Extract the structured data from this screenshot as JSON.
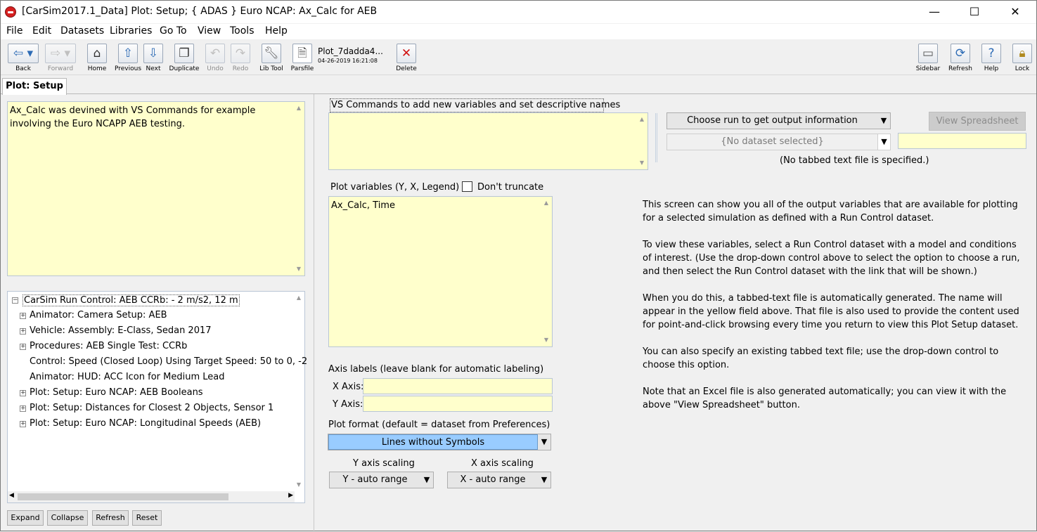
{
  "window": {
    "title": "[CarSim2017.1_Data] Plot: Setup; { ADAS } Euro NCAP: Ax_Calc for AEB",
    "minimize": "—",
    "maximize": "☐",
    "close": "✕"
  },
  "menu": [
    "File",
    "Edit",
    "Datasets",
    "Libraries",
    "Go To",
    "View",
    "Tools",
    "Help"
  ],
  "toolbar": {
    "back": "Back",
    "forward": "Forward",
    "home": "Home",
    "previous": "Previous",
    "next": "Next",
    "duplicate": "Duplicate",
    "undo": "Undo",
    "redo": "Redo",
    "lib_tool": "Lib Tool",
    "parsfile": "Parsfile",
    "parsfile_name": "Plot_7dadda4...",
    "parsfile_date": "04-26-2019 16:21:08",
    "delete": "Delete",
    "sidebar": "Sidebar",
    "refresh": "Refresh",
    "help": "Help",
    "lock": "Lock"
  },
  "tab": "Plot: Setup",
  "notes": "Ax_Calc was devined with VS Commands for example involving the Euro NCAPP AEB testing.",
  "tree": {
    "root": "CarSim Run Control: AEB  CCRb: - 2 m/s2, 12 m",
    "items": [
      "Animator: Camera Setup: AEB",
      "Vehicle: Assembly: E-Class, Sedan 2017",
      "Procedures: AEB Single Test: CCRb",
      "Control: Speed (Closed Loop) Using Target Speed: 50 to 0, -2",
      "Animator: HUD: ACC Icon for Medium Lead",
      "Plot: Setup: Euro NCAP: AEB Booleans",
      "Plot: Setup: Distances for Closest 2 Objects, Sensor 1",
      "Plot: Setup: Euro NCAP: Longitudinal Speeds (AEB)"
    ],
    "buttons": [
      "Expand",
      "Collapse",
      "Refresh",
      "Reset"
    ]
  },
  "middle": {
    "vs_label": "VS Commands to add new variables and set descriptive names",
    "vs_value": "",
    "plot_vars_label": "Plot variables  (Y, X, Legend)",
    "dont_truncate": "Don't truncate",
    "plot_vars_value": "Ax_Calc, Time",
    "axis_labels_title": "Axis labels (leave blank for automatic labeling)",
    "x_axis_label": "X Axis:",
    "y_axis_label": "Y Axis:",
    "x_axis_value": "",
    "y_axis_value": "",
    "plot_format_label": "Plot format (default = dataset from Preferences)",
    "plot_format_value": "Lines without Symbols",
    "y_scaling_label": "Y axis scaling",
    "x_scaling_label": "X axis scaling",
    "y_scaling_value": "Y - auto range",
    "x_scaling_value": "X - auto range"
  },
  "right": {
    "choose_run": "Choose run to get output information",
    "dataset_selected": "{No dataset selected}",
    "view_spreadsheet": "View  Spreadsheet",
    "no_file": "(No tabbed text file is specified.)",
    "paragraphs": [
      "This screen can show you all of the output  variables that are available for plotting for a selected simulation as defined with a Run Control dataset.",
      "To view these variables, select a Run Control dataset with a model and conditions of interest. (Use the drop-down control above to select the option to choose a run, and then select the Run Control dataset with the link that will be shown.)",
      "When you do this, a tabbed-text file is automatically generated. The name will appear in the yellow field above. That file is also used to provide the content used for point-and-click browsing every time you return to view this Plot Setup dataset.",
      "You can also specify an existing tabbed text file; use the drop-down control to choose this option.",
      "Note that an Excel file is also generated automatically; you can view it with the above \"View Spreadsheet\" button."
    ]
  }
}
